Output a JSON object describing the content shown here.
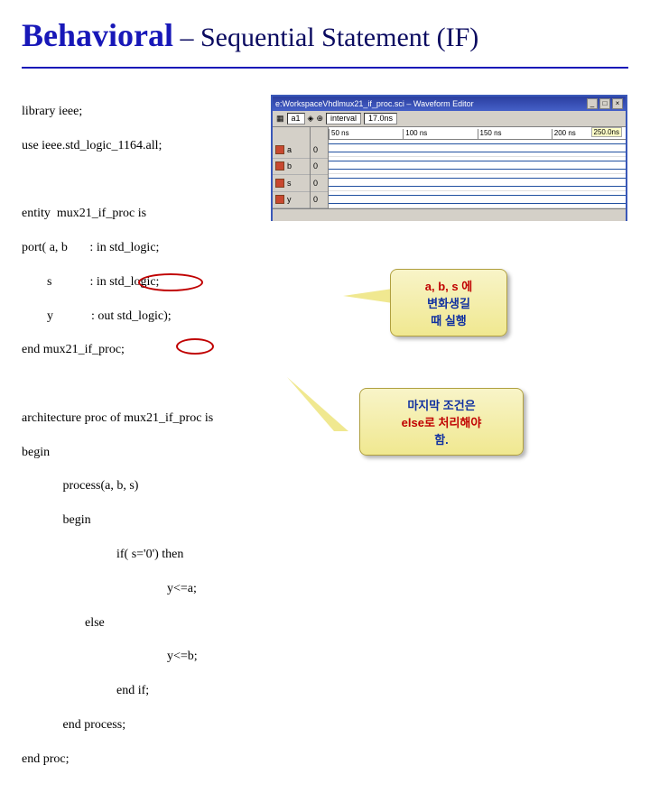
{
  "title": {
    "main": "Behavioral",
    "sub": " – Sequential Statement (IF)"
  },
  "code": {
    "lib1": "library ieee;",
    "lib2": "use ieee.std_logic_1164.all;",
    "ent1": "entity  mux21_if_proc is",
    "ent2": "port( a, b       : in std_logic;",
    "ent3": "        s            : in std_logic;",
    "ent4": "        y            : out std_logic);",
    "ent5": "end mux21_if_proc;",
    "arch1": "architecture proc of mux21_if_proc is",
    "arch2": "begin",
    "proc1": "             process(a, b, s)",
    "proc2": "             begin",
    "if1": "                              if( s='0') then",
    "if2": "                                              y<=a;",
    "if3": "                    else",
    "if4": "                                              y<=b;",
    "if5": "                              end if;",
    "proc3": "             end process;",
    "arch3": "end proc;"
  },
  "waveform": {
    "title": "e:WorkspaceVhdlmux21_if_proc.sci – Waveform Editor",
    "marker": "250.0ns",
    "field1": "a1",
    "field2": "interval",
    "field3": "17.0ns",
    "ticks": [
      "50 ns",
      "100 ns",
      "150 ns",
      "200 ns"
    ],
    "signals": [
      {
        "name": "a",
        "val": "0"
      },
      {
        "name": "b",
        "val": "0"
      },
      {
        "name": "s",
        "val": "0"
      },
      {
        "name": "y",
        "val": "0"
      }
    ]
  },
  "callouts": {
    "c1_l1": "a,  b, s 에",
    "c1_l2": "변화생길",
    "c1_l3": "때 실행",
    "c2_l1": "마지막 조건은",
    "c2_l2": "else로 처리해야",
    "c2_l3": "함."
  }
}
